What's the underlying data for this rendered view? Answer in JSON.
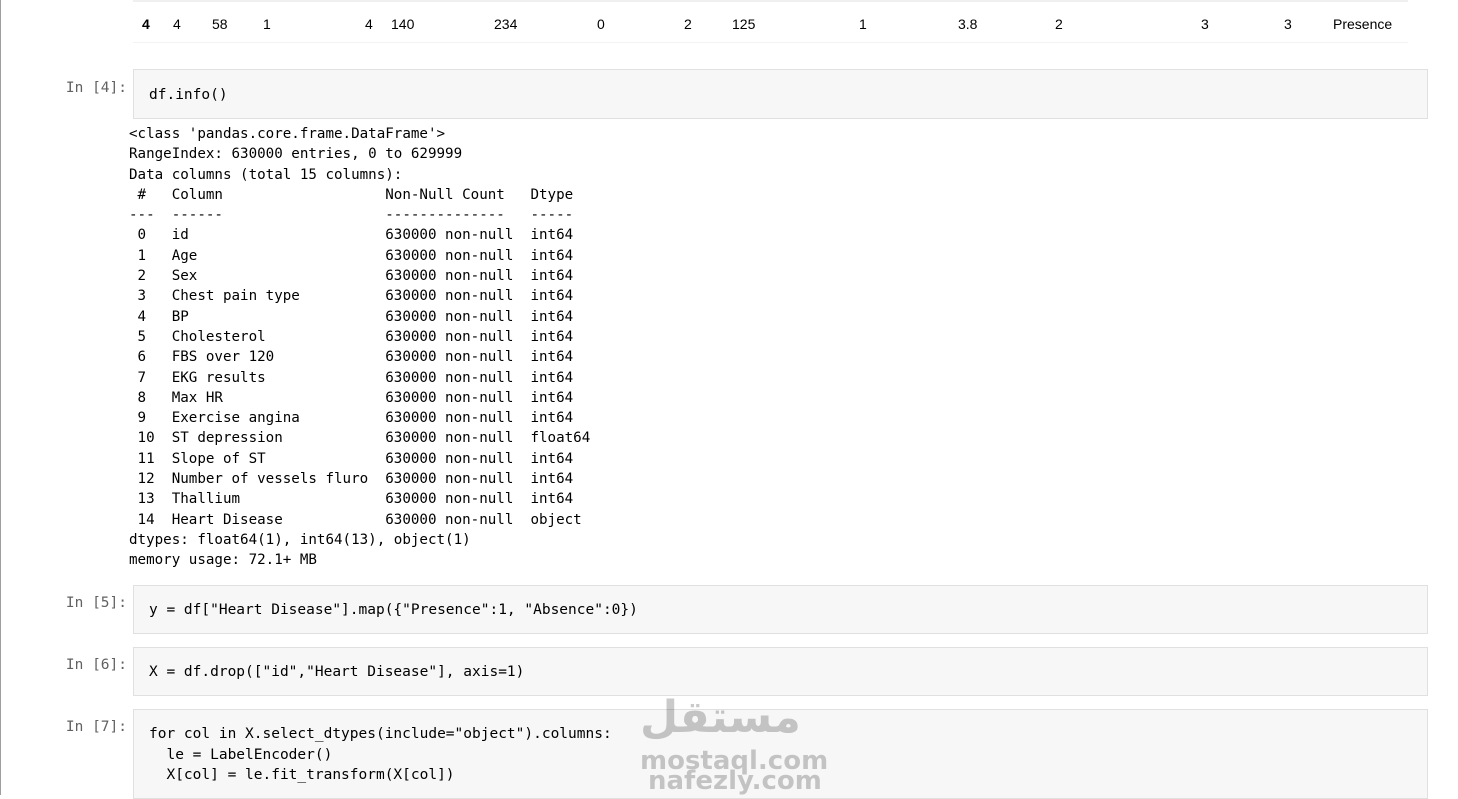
{
  "df_row": {
    "index": "4",
    "values": [
      "4",
      "58",
      "1",
      "4",
      "140",
      "234",
      "0",
      "2",
      "125",
      "1",
      "3.8",
      "2",
      "3",
      "3",
      "Presence"
    ]
  },
  "cells": [
    {
      "prompt": "In [4]:",
      "code": "df.info()"
    },
    {
      "prompt": "In [5]:",
      "code": "y = df[\"Heart Disease\"].map({\"Presence\":1, \"Absence\":0})"
    },
    {
      "prompt": "In [6]:",
      "code": "X = df.drop([\"id\",\"Heart Disease\"], axis=1)"
    },
    {
      "prompt": "In [7]:",
      "code_lines": [
        "for col in X.select_dtypes(include=\"object\").columns:",
        "  le = LabelEncoder()",
        "  X[col] = le.fit_transform(X[col])"
      ]
    }
  ],
  "info_output": [
    "<class 'pandas.core.frame.DataFrame'>",
    "RangeIndex: 630000 entries, 0 to 629999",
    "Data columns (total 15 columns):",
    " #   Column                   Non-Null Count   Dtype  ",
    "---  ------                   --------------   -----  ",
    " 0   id                       630000 non-null  int64  ",
    " 1   Age                      630000 non-null  int64  ",
    " 2   Sex                      630000 non-null  int64  ",
    " 3   Chest pain type          630000 non-null  int64  ",
    " 4   BP                       630000 non-null  int64  ",
    " 5   Cholesterol              630000 non-null  int64  ",
    " 6   FBS over 120             630000 non-null  int64  ",
    " 7   EKG results              630000 non-null  int64  ",
    " 8   Max HR                   630000 non-null  int64  ",
    " 9   Exercise angina          630000 non-null  int64  ",
    " 10  ST depression            630000 non-null  float64",
    " 11  Slope of ST              630000 non-null  int64  ",
    " 12  Number of vessels fluro  630000 non-null  int64  ",
    " 13  Thallium                 630000 non-null  int64  ",
    " 14  Heart Disease            630000 non-null  object ",
    "dtypes: float64(1), int64(13), object(1)",
    "memory usage: 72.1+ MB"
  ],
  "watermark": {
    "logo": "مستقل",
    "line1": "mostaql.com",
    "line2": "nafezly.com"
  }
}
